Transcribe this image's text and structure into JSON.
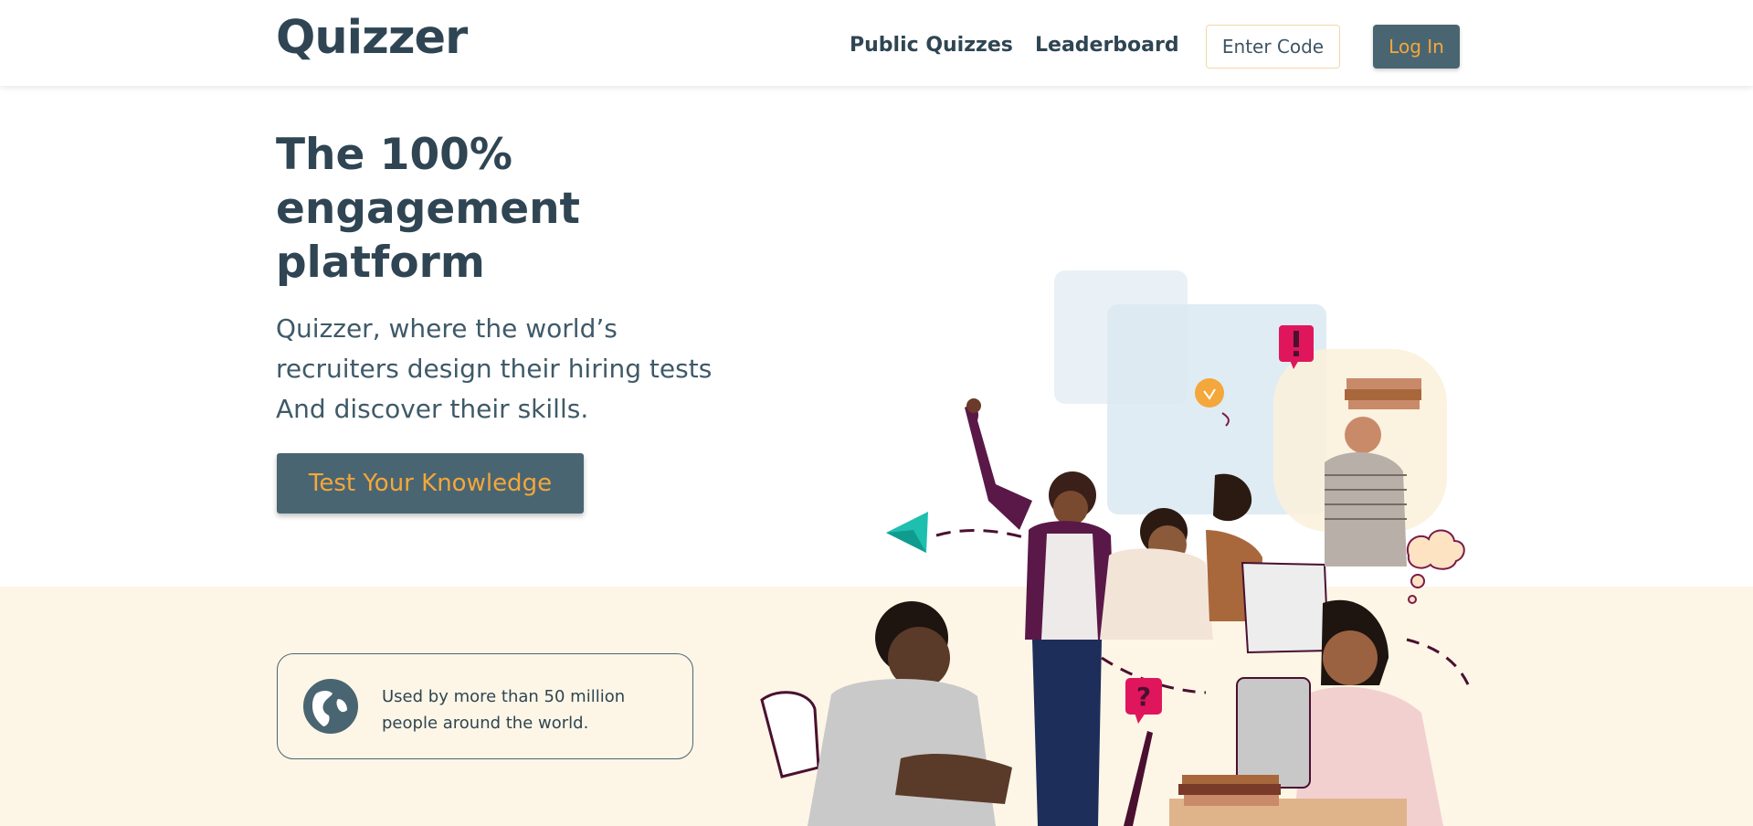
{
  "header": {
    "logo": "Quizzer",
    "nav": {
      "public_quizzes": "Public Quizzes",
      "leaderboard": "Leaderboard"
    },
    "enter_code_label": "Enter Code",
    "login_label": "Log In"
  },
  "hero": {
    "title_lines": [
      "The 100%",
      "engagement",
      "platform"
    ],
    "subtitle_lines": [
      "Quizzer, where the world’s",
      "recruiters design their hiring tests",
      "And discover their skills."
    ],
    "cta_label": "Test Your Knowledge"
  },
  "stats": {
    "icon": "globe-icon",
    "text_lines": [
      "Used by more than 50 million",
      "people around the world."
    ]
  },
  "colors": {
    "primary": "#4a6572",
    "accent": "#f4a73a",
    "text": "#2f4553",
    "band": "#fdf6e6",
    "magenta": "#e0165c"
  }
}
